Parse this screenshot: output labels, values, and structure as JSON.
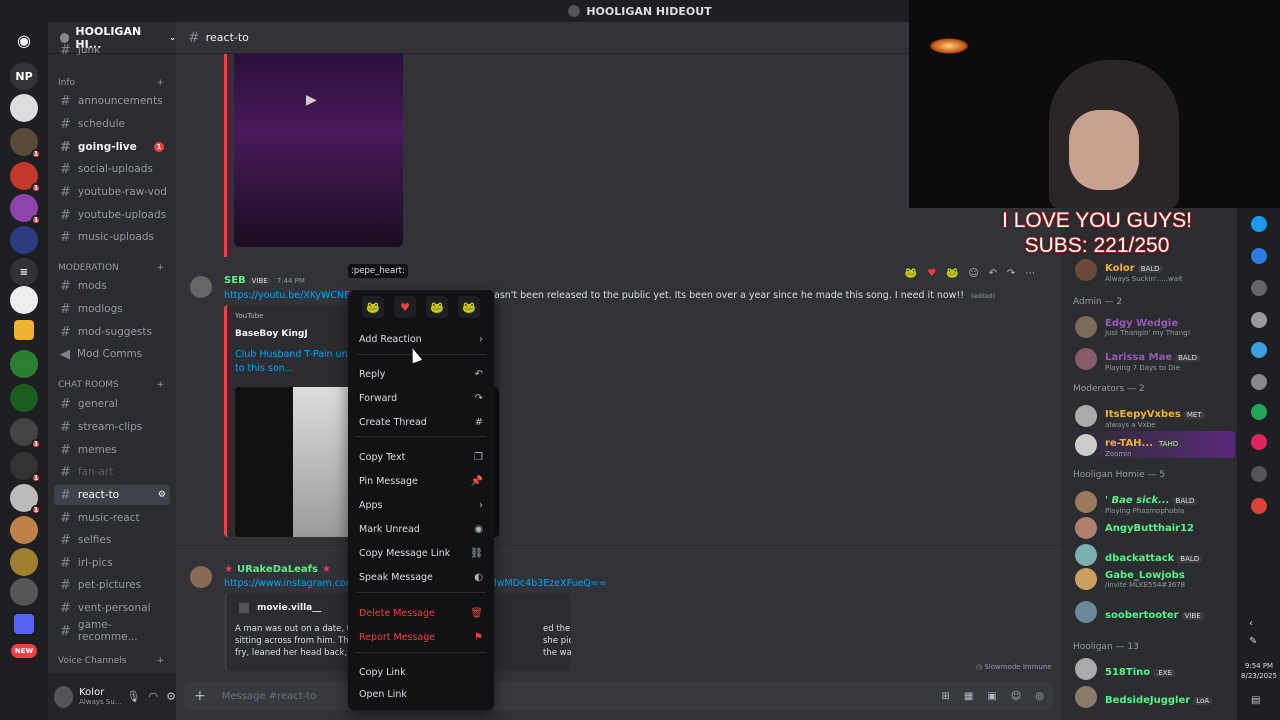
{
  "titlebar": {
    "title": "HOOLIGAN HIDEOUT"
  },
  "server": {
    "name": "HOOLIGAN HI...",
    "np_label": "NP"
  },
  "channels": {
    "partial_top": "junk",
    "info_label": "Info",
    "info": [
      "announcements",
      "schedule",
      "going-live",
      "social-uploads",
      "youtube-raw-vod",
      "youtube-uploads",
      "music-uploads"
    ],
    "going_live_badge": "1",
    "moderation_label": "MODERATION",
    "moderation": [
      "mods",
      "modlogs",
      "mod-suggests",
      "Mod Comms"
    ],
    "chat_label": "CHAT ROOMS",
    "chat": [
      "general",
      "stream-clips",
      "memes",
      "fan-art",
      "react-to",
      "music-react",
      "selfies",
      "irl-pics",
      "pet-pictures",
      "vent-personal",
      "game-recomme..."
    ],
    "voice_label": "Voice Channels"
  },
  "user": {
    "name": "Kolor",
    "status": "Always Su..."
  },
  "new_badge": "NEW",
  "chat": {
    "channel": "react-to",
    "input_placeholder": "Message #react-to",
    "slowmode": "Slowmode Immune",
    "msg1": {
      "author": "SEB",
      "tag": "VIBE",
      "time": "7:44 PM",
      "link": "https://youtu.be/XKyWCNE",
      "text": "asn't been released to the public yet. Its been over a year since he made this song. I need it now!!",
      "edited": "(edited)",
      "embed_source": "YouTube",
      "embed_author": "BaseBoy KingJ",
      "embed_title": "Club Husband T-Pain un",
      "embed_title2": "to this son..."
    },
    "msg2": {
      "author": "URakeDaLeafs",
      "link": "https://www.instagram.com",
      "link_tail": "lwMDc4b3EzeXFueQ==",
      "embed_author": "movie.villa__",
      "embed_text_l1": "A man was out on a date, try",
      "embed_text_r1": "ed the woman",
      "embed_text_l2": "sitting across from him. Thin",
      "embed_text_r2": "she picked up a",
      "embed_text_l3": "fry, leaned her head back, an",
      "embed_text_r3": "the way a"
    }
  },
  "tooltip": ":pepe_heart:",
  "context_menu": {
    "items": [
      {
        "label": "Add Reaction",
        "icon": "chevron-right-icon"
      },
      {
        "label": "Reply",
        "icon": "reply-icon"
      },
      {
        "label": "Forward",
        "icon": "forward-icon"
      },
      {
        "label": "Create Thread",
        "icon": "thread-icon"
      },
      {
        "label": "Copy Text",
        "icon": "copy-icon"
      },
      {
        "label": "Pin Message",
        "icon": "pin-icon"
      },
      {
        "label": "Apps",
        "icon": "chevron-right-icon"
      },
      {
        "label": "Mark Unread",
        "icon": "unread-icon"
      },
      {
        "label": "Copy Message Link",
        "icon": "link-icon"
      },
      {
        "label": "Speak Message",
        "icon": "speaker-icon"
      },
      {
        "label": "Delete Message",
        "icon": "trash-icon"
      },
      {
        "label": "Report Message",
        "icon": "flag-icon"
      },
      {
        "label": "Copy Link",
        "icon": ""
      },
      {
        "label": "Open Link",
        "icon": ""
      }
    ]
  },
  "overlay": {
    "line1": "I LOVE YOU GUYS!",
    "line2": "SUBS: 221/250"
  },
  "members": {
    "top_member": {
      "name": "Kolor",
      "tag": "BALD",
      "status": "Always Suckin'.....wait"
    },
    "admin_header": "Admin — 2",
    "admins": [
      {
        "name": "Edgy Wedgie",
        "status": "Just Thangin' my Thang!",
        "color": "#9b59b6"
      },
      {
        "name": "Larissa Mae",
        "tag": "BALD",
        "status": "Playing 7 Days to Die",
        "color": "#9b59b6"
      }
    ],
    "mod_header": "Moderators — 2",
    "mods": [
      {
        "name": "ItsEepyVxbes",
        "tag": "MET",
        "status": "always a Vxbe",
        "color": "#f0b232"
      },
      {
        "name": "re-TAH...",
        "tag": "TAHD",
        "status": "Zoomin",
        "color": "#f0b232"
      }
    ],
    "homie_header": "Hooligan Homie — 5",
    "homies": [
      {
        "name": "' Bae sick...",
        "tag": "BALD",
        "status": "Playing Phasmophobia",
        "color": "#57f287"
      },
      {
        "name": "AngyButthair12",
        "tag": "",
        "status": "",
        "color": "#57f287"
      },
      {
        "name": "dbackattack",
        "tag": "BALD",
        "status": "",
        "color": "#57f287"
      },
      {
        "name": "Gabe_Lowjobs",
        "tag": "",
        "status": "/invite MLKE554#3678",
        "color": "#57f287"
      },
      {
        "name": "soobertooter",
        "tag": "VIBE",
        "status": "",
        "color": "#57f287"
      }
    ],
    "hooligan_header": "Hooligan — 13",
    "hooligans": [
      {
        "name": "518Tino",
        "tag": ".EXE",
        "status": "",
        "color": "#57f287"
      },
      {
        "name": "BedsideJuggler",
        "tag": "LoA",
        "status": "",
        "color": "#57f287"
      }
    ]
  },
  "clock": {
    "time": "9:54 PM",
    "date": "8/23/2025"
  }
}
